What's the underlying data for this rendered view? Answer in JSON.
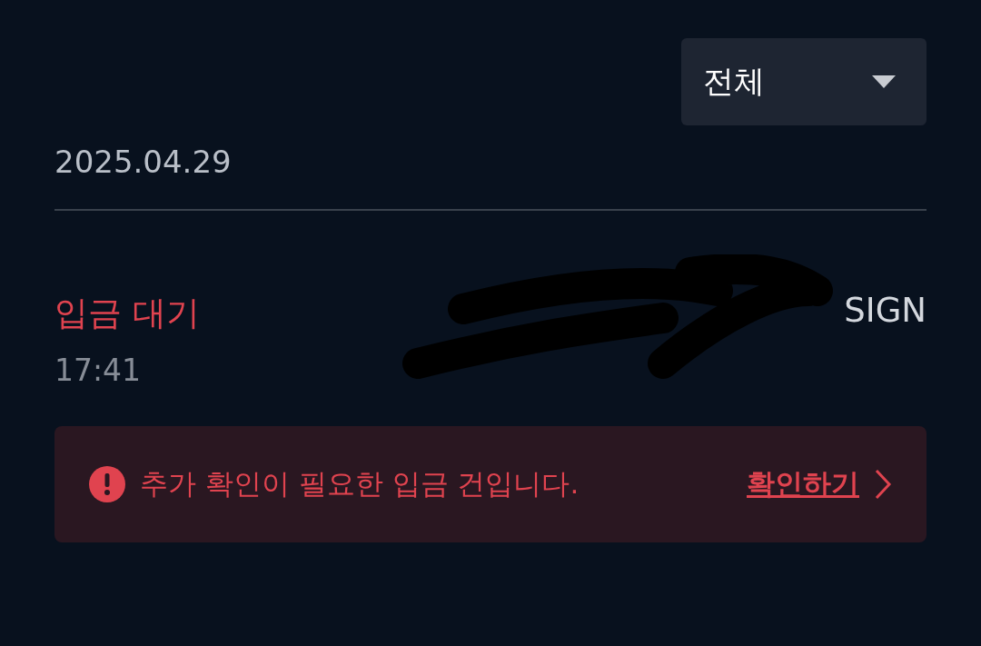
{
  "filter": {
    "value": "전체"
  },
  "date": "2025.04.29",
  "transaction": {
    "status": "입금 대기",
    "time": "17:41",
    "name": "SIGN"
  },
  "alert": {
    "message": "추가 확인이 필요한 입금 건입니다.",
    "link": "확인하기"
  }
}
